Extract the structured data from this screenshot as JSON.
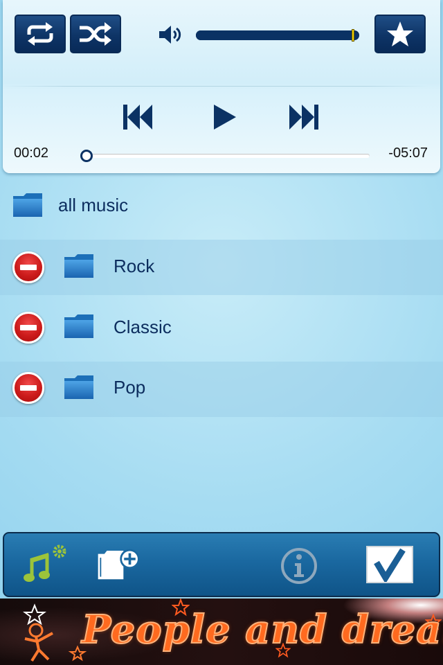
{
  "player": {
    "repeat_icon": "repeat-icon",
    "shuffle_icon": "shuffle-icon",
    "volume_icon": "speaker-icon",
    "volume_level": 0.97,
    "favorite_icon": "star-icon",
    "prev_icon": "skip-back-icon",
    "play_icon": "play-icon",
    "next_icon": "skip-forward-icon",
    "elapsed": "00:02",
    "remaining": "-05:07",
    "progress": 0.006
  },
  "list": {
    "all": {
      "label": "all music",
      "icon": "folder-icon"
    },
    "items": [
      {
        "label": "Rock",
        "icon": "folder-icon",
        "remove_icon": "remove-icon"
      },
      {
        "label": "Classic",
        "icon": "folder-icon",
        "remove_icon": "remove-icon"
      },
      {
        "label": "Pop",
        "icon": "folder-icon",
        "remove_icon": "remove-icon"
      }
    ]
  },
  "toolbar": {
    "music_settings_icon": "music-settings-icon",
    "add_folder_icon": "add-folder-icon",
    "info_icon": "info-icon",
    "done_icon": "checkmark-icon"
  },
  "banner": {
    "text": "People and dream"
  },
  "colors": {
    "accent": "#0b3264",
    "volume_thumb": "#f2d200",
    "remove_red": "#cc1b1b",
    "toolbar_blue": "#1a68a0",
    "banner_orange": "#ff6a1f"
  }
}
